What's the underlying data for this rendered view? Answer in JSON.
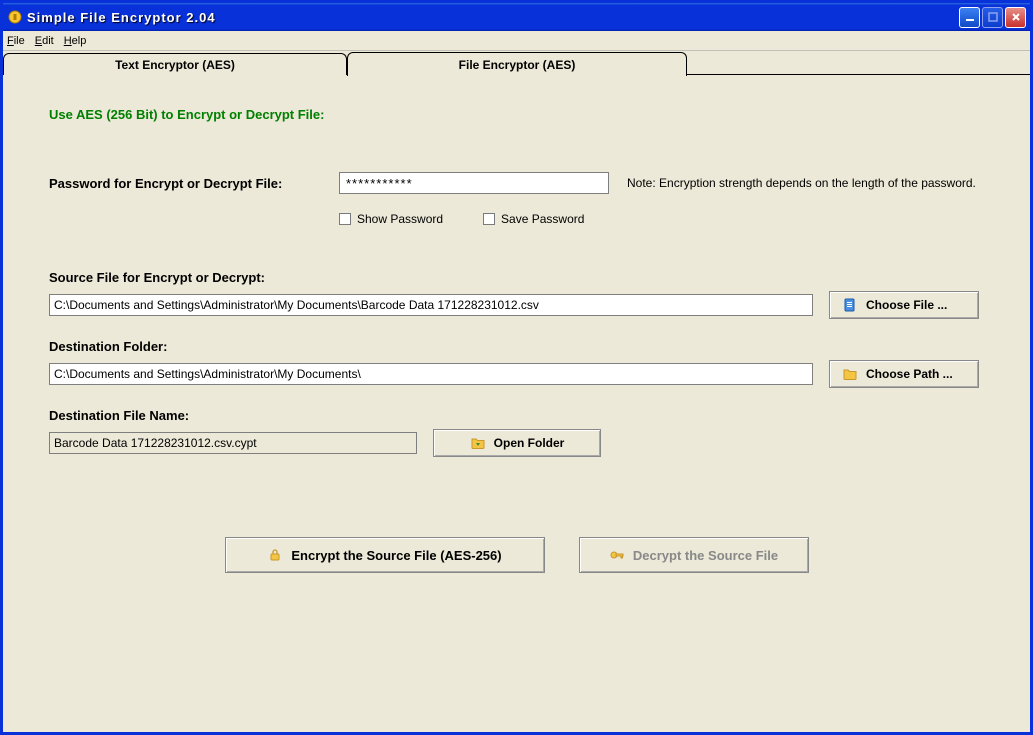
{
  "title": "Simple File Encryptor 2.04",
  "menu": {
    "file": "File",
    "edit": "Edit",
    "help": "Help"
  },
  "tabs": {
    "text": "Text  Encryptor (AES)",
    "file": "File  Encryptor (AES)"
  },
  "heading": "Use AES (256 Bit) to Encrypt or Decrypt File:",
  "password": {
    "label": "Password for Encrypt or Decrypt File:",
    "value": "***********",
    "note": "Note: Encryption strength depends on the length of the password.",
    "show": "Show Password",
    "save": "Save Password"
  },
  "source": {
    "label": "Source File for Encrypt or Decrypt:",
    "value": "C:\\Documents and Settings\\Administrator\\My Documents\\Barcode Data 171228231012.csv",
    "choose": "Choose File ..."
  },
  "destination": {
    "label": "Destination Folder:",
    "value": "C:\\Documents and Settings\\Administrator\\My Documents\\",
    "choose": "Choose Path ..."
  },
  "dest_file": {
    "label": "Destination File Name:",
    "value": "Barcode Data 171228231012.csv.cypt",
    "open": "Open Folder"
  },
  "actions": {
    "encrypt": "Encrypt the Source File (AES-256)",
    "decrypt": "Decrypt the Source File"
  }
}
